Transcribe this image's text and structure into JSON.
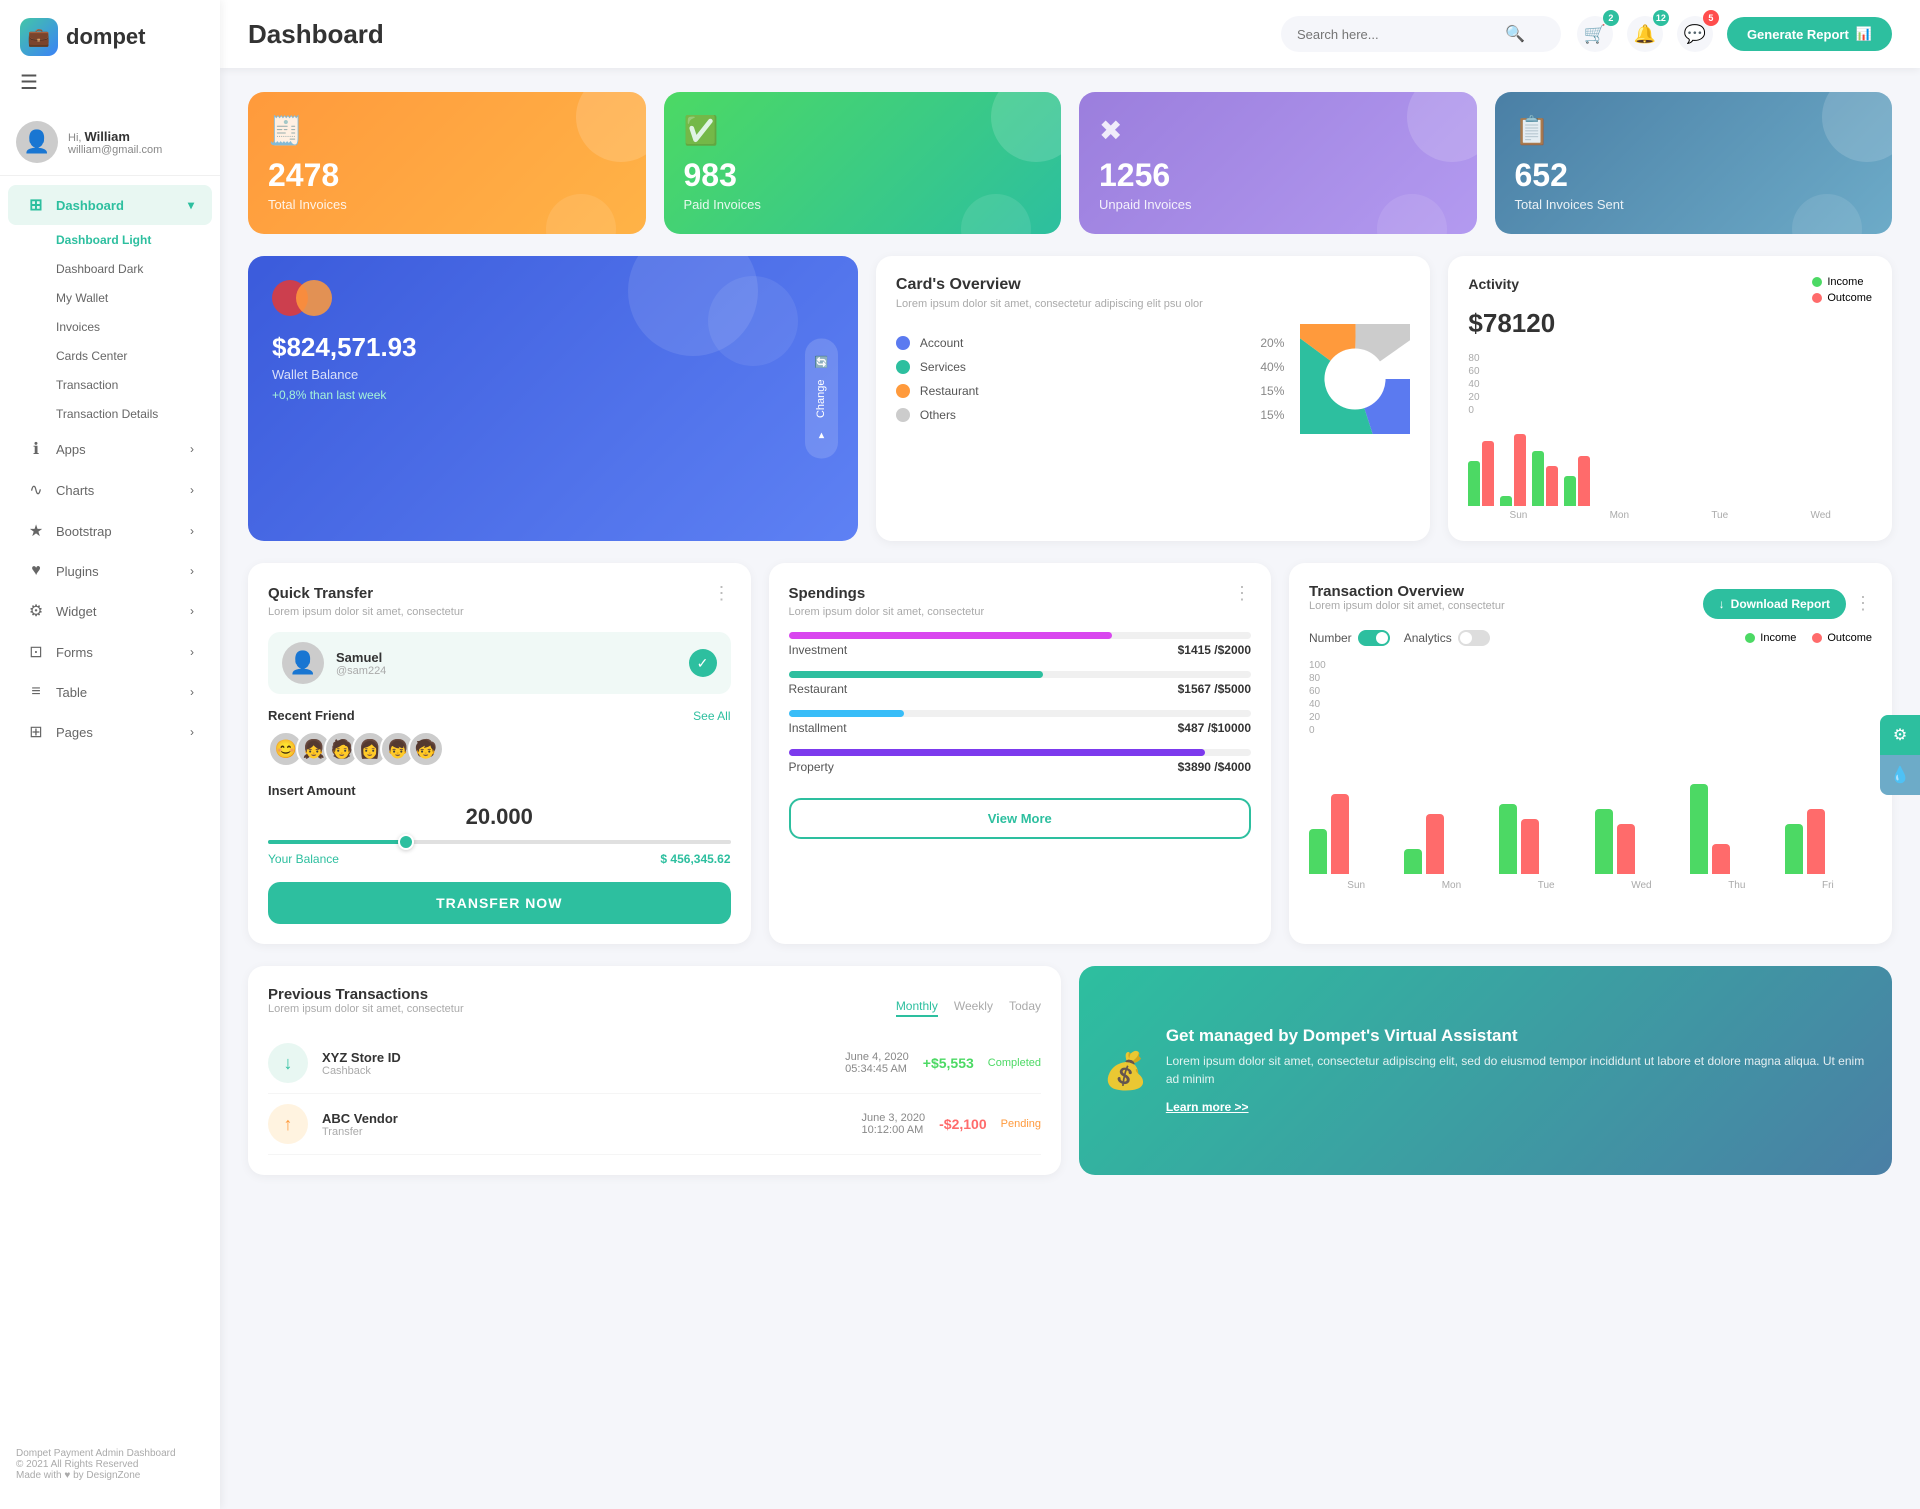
{
  "app": {
    "name": "dompet",
    "logo_emoji": "💼"
  },
  "header": {
    "title": "Dashboard",
    "search_placeholder": "Search here...",
    "generate_report_label": "Generate Report"
  },
  "header_icons": {
    "cart_badge": "2",
    "bell_badge": "12",
    "msg_badge": "5"
  },
  "user": {
    "greeting": "Hi,",
    "name": "William",
    "email": "william@gmail.com"
  },
  "sidebar": {
    "nav_main": [
      {
        "id": "dashboard",
        "label": "Dashboard",
        "icon": "⊞",
        "active": true,
        "has_arrow": true
      },
      {
        "id": "apps",
        "label": "Apps",
        "icon": "ℹ",
        "has_arrow": true
      },
      {
        "id": "charts",
        "label": "Charts",
        "icon": "∿",
        "has_arrow": true
      },
      {
        "id": "bootstrap",
        "label": "Bootstrap",
        "icon": "★",
        "has_arrow": true
      },
      {
        "id": "plugins",
        "label": "Plugins",
        "icon": "♥",
        "has_arrow": true
      },
      {
        "id": "widget",
        "label": "Widget",
        "icon": "⚙",
        "has_arrow": true
      },
      {
        "id": "forms",
        "label": "Forms",
        "icon": "⊡",
        "has_arrow": true
      },
      {
        "id": "table",
        "label": "Table",
        "icon": "≡",
        "has_arrow": true
      },
      {
        "id": "pages",
        "label": "Pages",
        "icon": "⊞",
        "has_arrow": true
      }
    ],
    "sub_nav": [
      {
        "id": "dashboard-light",
        "label": "Dashboard Light",
        "active": true
      },
      {
        "id": "dashboard-dark",
        "label": "Dashboard Dark"
      },
      {
        "id": "my-wallet",
        "label": "My Wallet"
      },
      {
        "id": "invoices",
        "label": "Invoices"
      },
      {
        "id": "cards-center",
        "label": "Cards Center"
      },
      {
        "id": "transaction",
        "label": "Transaction"
      },
      {
        "id": "transaction-details",
        "label": "Transaction Details"
      }
    ],
    "footer_brand": "Dompet Payment Admin Dashboard",
    "footer_copy": "© 2021 All Rights Reserved",
    "footer_made": "Made with ♥ by DesignZone"
  },
  "stats": [
    {
      "id": "total-invoices",
      "number": "2478",
      "label": "Total Invoices",
      "icon": "🧾",
      "color": "orange"
    },
    {
      "id": "paid-invoices",
      "number": "983",
      "label": "Paid Invoices",
      "icon": "✅",
      "color": "green"
    },
    {
      "id": "unpaid-invoices",
      "number": "1256",
      "label": "Unpaid Invoices",
      "icon": "✖",
      "color": "purple"
    },
    {
      "id": "total-sent",
      "number": "652",
      "label": "Total Invoices Sent",
      "icon": "📋",
      "color": "teal"
    }
  ],
  "wallet": {
    "amount": "$824,571.93",
    "label": "Wallet Balance",
    "change": "+0,8% than last week",
    "change_btn_label": "Change"
  },
  "cards_overview": {
    "title": "Card's Overview",
    "desc": "Lorem ipsum dolor sit amet, consectetur adipiscing elit psu olor",
    "items": [
      {
        "label": "Account",
        "pct": "20%",
        "color": "#5b7af0"
      },
      {
        "label": "Services",
        "pct": "40%",
        "color": "#2dbf9f"
      },
      {
        "label": "Restaurant",
        "pct": "15%",
        "color": "#ff9a3c"
      },
      {
        "label": "Others",
        "pct": "15%",
        "color": "#ccc"
      }
    ],
    "pie_data": [
      {
        "label": "Account",
        "value": 20,
        "color": "#5b7af0"
      },
      {
        "label": "Services",
        "value": 40,
        "color": "#2dbf9f"
      },
      {
        "label": "Restaurant",
        "value": 15,
        "color": "#ff9a3c"
      },
      {
        "label": "Others",
        "value": 15,
        "color": "#ccc"
      }
    ]
  },
  "activity": {
    "title": "Activity",
    "amount": "$78120",
    "income_label": "Income",
    "outcome_label": "Outcome",
    "income_color": "#4cd964",
    "outcome_color": "#ff6b6b",
    "bars": [
      {
        "day": "Sun",
        "income": 45,
        "outcome": 65
      },
      {
        "day": "Mon",
        "income": 10,
        "outcome": 72
      },
      {
        "day": "Tue",
        "income": 55,
        "outcome": 40
      },
      {
        "day": "Wed",
        "income": 30,
        "outcome": 50
      }
    ]
  },
  "quick_transfer": {
    "title": "Quick Transfer",
    "desc": "Lorem ipsum dolor sit amet, consectetur",
    "user_name": "Samuel",
    "user_handle": "@sam224",
    "recent_friend_label": "Recent Friend",
    "see_more_label": "See All",
    "insert_amount_label": "Insert Amount",
    "amount": "20.000",
    "balance_label": "Your Balance",
    "balance_value": "$ 456,345.62",
    "transfer_btn_label": "TRANSFER NOW",
    "friends": [
      "😊",
      "👧",
      "🧑",
      "👩",
      "👦",
      "🧒"
    ]
  },
  "spendings": {
    "title": "Spendings",
    "desc": "Lorem ipsum dolor sit amet, consectetur",
    "items": [
      {
        "label": "Investment",
        "current": "$1415",
        "max": "$2000",
        "pct": 70,
        "color": "#d946ef"
      },
      {
        "label": "Restaurant",
        "current": "$1567",
        "max": "$5000",
        "pct": 55,
        "color": "#2dbf9f"
      },
      {
        "label": "Installment",
        "current": "$487",
        "max": "$10000",
        "pct": 25,
        "color": "#38bdf8"
      },
      {
        "label": "Property",
        "current": "$3890",
        "max": "$4000",
        "pct": 90,
        "color": "#7c3aed"
      }
    ],
    "view_more_label": "View More"
  },
  "transaction_overview": {
    "title": "Transaction Overview",
    "desc": "Lorem ipsum dolor sit amet, consectetur",
    "download_label": "Download Report",
    "number_label": "Number",
    "analytics_label": "Analytics",
    "income_label": "Income",
    "outcome_label": "Outcome",
    "income_color": "#4cd964",
    "outcome_color": "#ff6b6b",
    "bars": [
      {
        "day": "Sun",
        "income": 45,
        "outcome": 80
      },
      {
        "day": "Mon",
        "income": 25,
        "outcome": 60
      },
      {
        "day": "Tue",
        "income": 70,
        "outcome": 55
      },
      {
        "day": "Wed",
        "income": 65,
        "outcome": 50
      },
      {
        "day": "Thu",
        "income": 90,
        "outcome": 30
      },
      {
        "day": "Fri",
        "income": 50,
        "outcome": 65
      }
    ]
  },
  "previous_transactions": {
    "title": "Previous Transactions",
    "desc": "Lorem ipsum dolor sit amet, consectetur",
    "tabs": [
      "Monthly",
      "Weekly",
      "Today"
    ],
    "active_tab": "Monthly",
    "rows": [
      {
        "name": "XYZ Store ID",
        "sub": "Cashback",
        "date": "June 4, 2020",
        "time": "05:34:45 AM",
        "amount": "+$5,553",
        "status": "Completed",
        "icon": "↓"
      }
    ]
  },
  "virtual_assistant": {
    "title": "Get managed by Dompet's Virtual Assistant",
    "desc": "Lorem ipsum dolor sit amet, consectetur adipiscing elit, sed do eiusmod tempor incididunt ut labore et dolore magna aliqua. Ut enim ad minim",
    "link_label": "Learn more >>",
    "icon": "💰"
  }
}
